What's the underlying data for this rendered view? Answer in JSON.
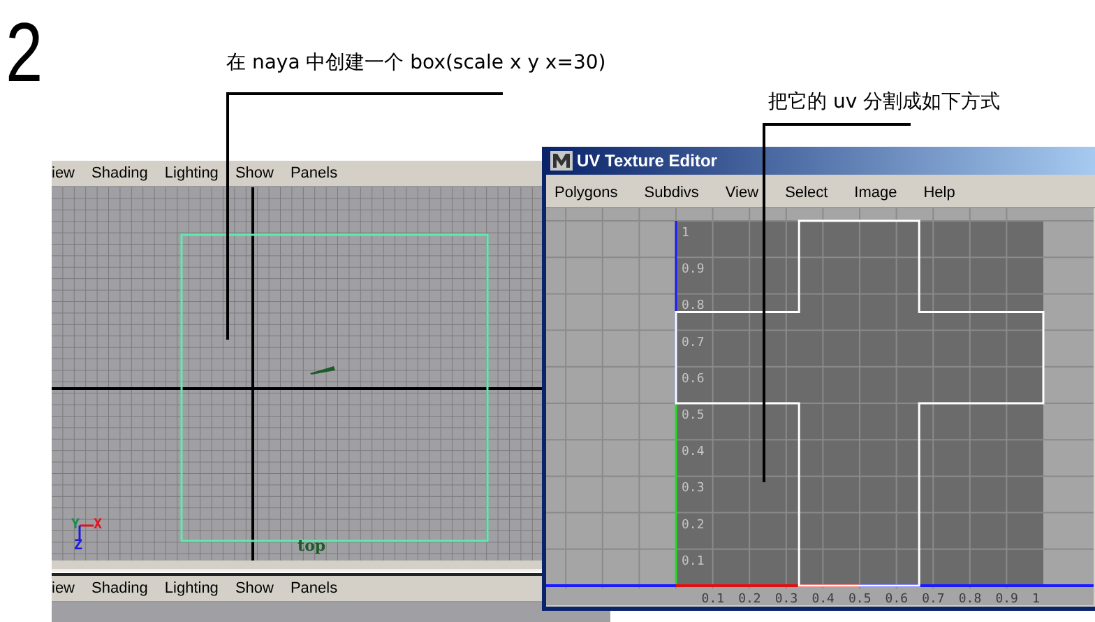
{
  "step_number": "2",
  "annotations": [
    {
      "text": "在 naya 中创建一个 box(scale x y x=30)"
    },
    {
      "text": "把它的 uv 分割成如下方式"
    }
  ],
  "viewport_top": {
    "menu": [
      "iew",
      "Shading",
      "Lighting",
      "Show",
      "Panels"
    ],
    "camera_label": "top",
    "axis_labels": [
      "Y",
      "X",
      "Z"
    ]
  },
  "uv_editor": {
    "title": "UV Texture Editor",
    "menu": [
      "Polygons",
      "Subdivs",
      "View",
      "Select",
      "Image",
      "Help"
    ],
    "v_labels": [
      "1",
      "0.9",
      "0.8",
      "0.7",
      "0.6",
      "0.5",
      "0.4",
      "0.3",
      "0.2",
      "0.1"
    ],
    "u_labels": [
      "0.1",
      "0.2",
      "0.3",
      "0.4",
      "0.5",
      "0.6",
      "0.7",
      "0.8",
      "0.9",
      "1"
    ]
  },
  "viewport_bottom": {
    "menu": [
      "iew",
      "Shading",
      "Lighting",
      "Show",
      "Panels"
    ]
  }
}
